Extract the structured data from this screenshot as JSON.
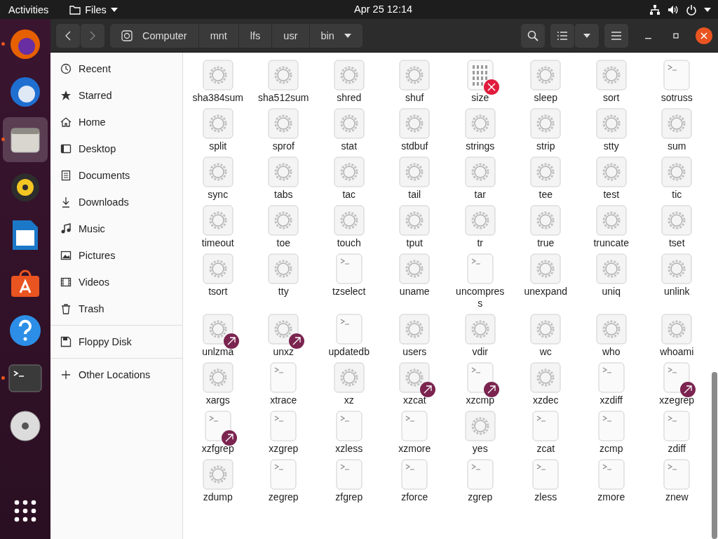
{
  "top_bar": {
    "activities": "Activities",
    "app_menu": "Files",
    "clock": "Apr 25  12:14"
  },
  "dock": [
    {
      "running": true,
      "selected": false
    },
    {
      "running": false,
      "selected": false
    },
    {
      "running": true,
      "selected": true
    },
    {
      "running": false,
      "selected": false
    },
    {
      "running": false,
      "selected": false
    },
    {
      "running": false,
      "selected": false
    },
    {
      "running": false,
      "selected": false
    },
    {
      "running": true,
      "selected": false
    },
    {
      "running": false,
      "selected": false
    },
    {
      "running": false,
      "selected": false
    }
  ],
  "path_bar": [
    {
      "label": "Computer",
      "kind": "root"
    },
    {
      "label": "mnt",
      "kind": "folder"
    },
    {
      "label": "lfs",
      "kind": "folder"
    },
    {
      "label": "usr",
      "kind": "folder"
    },
    {
      "label": "bin",
      "kind": "current"
    }
  ],
  "sidebar": {
    "places": [
      {
        "label": "Recent"
      },
      {
        "label": "Starred"
      },
      {
        "label": "Home"
      },
      {
        "label": "Desktop"
      },
      {
        "label": "Documents"
      },
      {
        "label": "Downloads"
      },
      {
        "label": "Music"
      },
      {
        "label": "Pictures"
      },
      {
        "label": "Videos"
      },
      {
        "label": "Trash"
      }
    ],
    "devices": [
      {
        "label": "Floppy Disk"
      }
    ],
    "other": [
      {
        "label": "Other Locations"
      }
    ]
  },
  "files": [
    {
      "name": "sha384sum",
      "kind": "program",
      "link": false,
      "broken": false
    },
    {
      "name": "sha512sum",
      "kind": "program",
      "link": false,
      "broken": false
    },
    {
      "name": "shred",
      "kind": "program",
      "link": false,
      "broken": false
    },
    {
      "name": "shuf",
      "kind": "program",
      "link": false,
      "broken": false
    },
    {
      "name": "size",
      "kind": "binary",
      "link": false,
      "broken": true
    },
    {
      "name": "sleep",
      "kind": "program",
      "link": false,
      "broken": false
    },
    {
      "name": "sort",
      "kind": "program",
      "link": false,
      "broken": false
    },
    {
      "name": "sotruss",
      "kind": "script",
      "link": false,
      "broken": false
    },
    {
      "name": "split",
      "kind": "program",
      "link": false,
      "broken": false
    },
    {
      "name": "sprof",
      "kind": "program",
      "link": false,
      "broken": false
    },
    {
      "name": "stat",
      "kind": "program",
      "link": false,
      "broken": false
    },
    {
      "name": "stdbuf",
      "kind": "program",
      "link": false,
      "broken": false
    },
    {
      "name": "strings",
      "kind": "program",
      "link": false,
      "broken": false
    },
    {
      "name": "strip",
      "kind": "program",
      "link": false,
      "broken": false
    },
    {
      "name": "stty",
      "kind": "program",
      "link": false,
      "broken": false
    },
    {
      "name": "sum",
      "kind": "program",
      "link": false,
      "broken": false
    },
    {
      "name": "sync",
      "kind": "program",
      "link": false,
      "broken": false
    },
    {
      "name": "tabs",
      "kind": "program",
      "link": false,
      "broken": false
    },
    {
      "name": "tac",
      "kind": "program",
      "link": false,
      "broken": false
    },
    {
      "name": "tail",
      "kind": "program",
      "link": false,
      "broken": false
    },
    {
      "name": "tar",
      "kind": "program",
      "link": false,
      "broken": false
    },
    {
      "name": "tee",
      "kind": "program",
      "link": false,
      "broken": false
    },
    {
      "name": "test",
      "kind": "program",
      "link": false,
      "broken": false
    },
    {
      "name": "tic",
      "kind": "program",
      "link": false,
      "broken": false
    },
    {
      "name": "timeout",
      "kind": "program",
      "link": false,
      "broken": false
    },
    {
      "name": "toe",
      "kind": "program",
      "link": false,
      "broken": false
    },
    {
      "name": "touch",
      "kind": "program",
      "link": false,
      "broken": false
    },
    {
      "name": "tput",
      "kind": "program",
      "link": false,
      "broken": false
    },
    {
      "name": "tr",
      "kind": "program",
      "link": false,
      "broken": false
    },
    {
      "name": "true",
      "kind": "program",
      "link": false,
      "broken": false
    },
    {
      "name": "truncate",
      "kind": "program",
      "link": false,
      "broken": false
    },
    {
      "name": "tset",
      "kind": "program",
      "link": false,
      "broken": false
    },
    {
      "name": "tsort",
      "kind": "program",
      "link": false,
      "broken": false
    },
    {
      "name": "tty",
      "kind": "program",
      "link": false,
      "broken": false
    },
    {
      "name": "tzselect",
      "kind": "script",
      "link": false,
      "broken": false
    },
    {
      "name": "uname",
      "kind": "program",
      "link": false,
      "broken": false
    },
    {
      "name": "uncompress",
      "kind": "script",
      "link": false,
      "broken": false
    },
    {
      "name": "unexpand",
      "kind": "program",
      "link": false,
      "broken": false
    },
    {
      "name": "uniq",
      "kind": "program",
      "link": false,
      "broken": false
    },
    {
      "name": "unlink",
      "kind": "program",
      "link": false,
      "broken": false
    },
    {
      "name": "unlzma",
      "kind": "program",
      "link": true,
      "broken": false
    },
    {
      "name": "unxz",
      "kind": "program",
      "link": true,
      "broken": false
    },
    {
      "name": "updatedb",
      "kind": "script",
      "link": false,
      "broken": false
    },
    {
      "name": "users",
      "kind": "program",
      "link": false,
      "broken": false
    },
    {
      "name": "vdir",
      "kind": "program",
      "link": false,
      "broken": false
    },
    {
      "name": "wc",
      "kind": "program",
      "link": false,
      "broken": false
    },
    {
      "name": "who",
      "kind": "program",
      "link": false,
      "broken": false
    },
    {
      "name": "whoami",
      "kind": "program",
      "link": false,
      "broken": false
    },
    {
      "name": "xargs",
      "kind": "program",
      "link": false,
      "broken": false
    },
    {
      "name": "xtrace",
      "kind": "script",
      "link": false,
      "broken": false
    },
    {
      "name": "xz",
      "kind": "program",
      "link": false,
      "broken": false
    },
    {
      "name": "xzcat",
      "kind": "program",
      "link": true,
      "broken": false
    },
    {
      "name": "xzcmp",
      "kind": "script",
      "link": true,
      "broken": false
    },
    {
      "name": "xzdec",
      "kind": "program",
      "link": false,
      "broken": false
    },
    {
      "name": "xzdiff",
      "kind": "script",
      "link": false,
      "broken": false
    },
    {
      "name": "xzegrep",
      "kind": "script",
      "link": true,
      "broken": false
    },
    {
      "name": "xzfgrep",
      "kind": "script",
      "link": true,
      "broken": false
    },
    {
      "name": "xzgrep",
      "kind": "script",
      "link": false,
      "broken": false
    },
    {
      "name": "xzless",
      "kind": "script",
      "link": false,
      "broken": false
    },
    {
      "name": "xzmore",
      "kind": "script",
      "link": false,
      "broken": false
    },
    {
      "name": "yes",
      "kind": "program",
      "link": false,
      "broken": false
    },
    {
      "name": "zcat",
      "kind": "script",
      "link": false,
      "broken": false
    },
    {
      "name": "zcmp",
      "kind": "script",
      "link": false,
      "broken": false
    },
    {
      "name": "zdiff",
      "kind": "script",
      "link": false,
      "broken": false
    },
    {
      "name": "zdump",
      "kind": "program",
      "link": false,
      "broken": false
    },
    {
      "name": "zegrep",
      "kind": "script",
      "link": false,
      "broken": false
    },
    {
      "name": "zfgrep",
      "kind": "script",
      "link": false,
      "broken": false
    },
    {
      "name": "zforce",
      "kind": "script",
      "link": false,
      "broken": false
    },
    {
      "name": "zgrep",
      "kind": "script",
      "link": false,
      "broken": false
    },
    {
      "name": "zless",
      "kind": "script",
      "link": false,
      "broken": false
    },
    {
      "name": "zmore",
      "kind": "script",
      "link": false,
      "broken": false
    },
    {
      "name": "znew",
      "kind": "script",
      "link": false,
      "broken": false
    }
  ]
}
